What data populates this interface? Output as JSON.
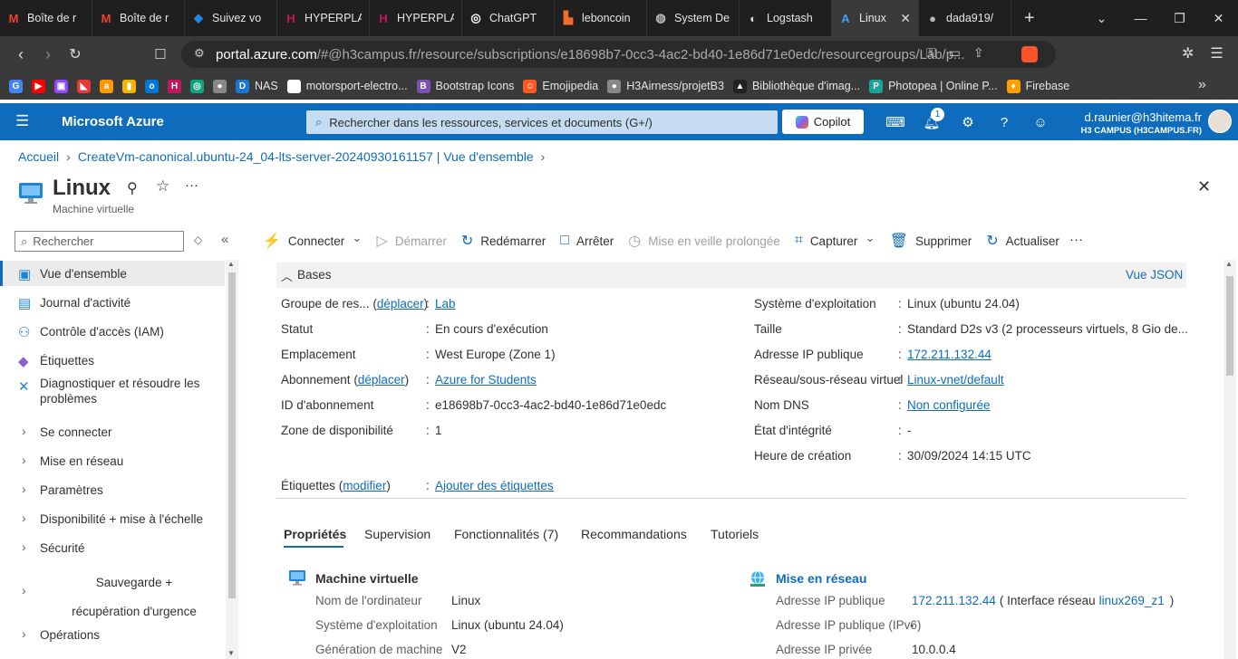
{
  "browser": {
    "tabs": [
      {
        "label": "Boîte de r",
        "icon": "gmail-icon",
        "color": "#ea4335"
      },
      {
        "label": "Boîte de r",
        "icon": "gmail-icon",
        "color": "#ea4335"
      },
      {
        "label": "Suivez vo",
        "icon": "cube-icon",
        "color": "#1e88e5"
      },
      {
        "label": "HYPERPLA",
        "icon": "hyperplan-icon",
        "color": "#c2185b"
      },
      {
        "label": "HYPERPLA",
        "icon": "hyperplan-icon",
        "color": "#c2185b"
      },
      {
        "label": "ChatGPT",
        "icon": "chatgpt-icon",
        "color": "#ffffff"
      },
      {
        "label": "leboncoin",
        "icon": "leboncoin-icon",
        "color": "#f56b2a"
      },
      {
        "label": "System De",
        "icon": "globe-icon",
        "color": "#bbbbbb"
      },
      {
        "label": "Logstash",
        "icon": "logstash-icon",
        "color": "#dddddd"
      },
      {
        "label": "Linux",
        "icon": "azure-icon",
        "color": "#3ba0ff",
        "active": true
      },
      {
        "label": "dada919/",
        "icon": "github-icon",
        "color": "#bbbbbb"
      }
    ],
    "url_host": "portal.azure.com",
    "url_rest": "/#@h3campus.fr/resource/subscriptions/e18698b7-0cc3-4ac2-bd40-1e86d71e0edc/resourcegroups/Lab/p...",
    "bookmarks": [
      {
        "label": "",
        "icon": "google-icon"
      },
      {
        "label": "",
        "icon": "youtube-icon"
      },
      {
        "label": "",
        "icon": "twitch-icon"
      },
      {
        "label": "",
        "icon": "bookmark-red-icon"
      },
      {
        "label": "",
        "icon": "amazon-icon"
      },
      {
        "label": "",
        "icon": "stats-icon"
      },
      {
        "label": "",
        "icon": "outlook-icon"
      },
      {
        "label": "",
        "icon": "hyperplan-icon"
      },
      {
        "label": "",
        "icon": "chatgpt-icon"
      },
      {
        "label": "",
        "icon": "github-icon"
      },
      {
        "label": "NAS",
        "icon": "dsm-icon"
      },
      {
        "label": "motorsport-electro...",
        "icon": "globe-icon"
      },
      {
        "label": "Bootstrap Icons",
        "icon": "bootstrap-icon"
      },
      {
        "label": "Emojipedia",
        "icon": "emoji-icon"
      },
      {
        "label": "H3Airness/projetB3",
        "icon": "github-icon"
      },
      {
        "label": "Bibliothèque d'imag...",
        "icon": "bib-icon"
      },
      {
        "label": "Photopea | Online P...",
        "icon": "photopea-icon"
      },
      {
        "label": "Firebase",
        "icon": "firebase-icon"
      }
    ]
  },
  "azure": {
    "brand": "Microsoft Azure",
    "search_placeholder": "Rechercher dans les ressources, services et documents (G+/)",
    "copilot": "Copilot",
    "notif_count": "1",
    "user_email": "d.raunier@h3hitema.fr",
    "user_tenant": "H3 CAMPUS (H3CAMPUS.FR)"
  },
  "breadcrumb": [
    "Accueil",
    "CreateVm-canonical.ubuntu-24_04-lts-server-20240930161157 | Vue d'ensemble"
  ],
  "page": {
    "title": "Linux",
    "subtitle": "Machine virtuelle",
    "more": "···"
  },
  "sidebar": {
    "search_placeholder": "Rechercher",
    "items": [
      {
        "label": "Vue d'ensemble",
        "kind": "icon",
        "icon": "monitor-icon",
        "active": true
      },
      {
        "label": "Journal d'activité",
        "kind": "icon",
        "icon": "log-icon"
      },
      {
        "label": "Contrôle d'accès (IAM)",
        "kind": "icon",
        "icon": "people-icon"
      },
      {
        "label": "Étiquettes",
        "kind": "icon",
        "icon": "tag-icon"
      },
      {
        "label": "Diagnostiquer et résoudre les problèmes",
        "kind": "icon",
        "icon": "wrench-icon"
      },
      {
        "label": "Se connecter",
        "kind": "chev"
      },
      {
        "label": "Mise en réseau",
        "kind": "chev"
      },
      {
        "label": "Paramètres",
        "kind": "chev"
      },
      {
        "label": "Disponibilité + mise à l'échelle",
        "kind": "chev"
      },
      {
        "label": "Sécurité",
        "kind": "chev"
      },
      {
        "label": "Sauvegarde + récupération d'urgence",
        "kind": "chev"
      },
      {
        "label": "Opérations",
        "kind": "chev"
      }
    ]
  },
  "commands": [
    {
      "label": "Connecter",
      "icon": "plug-icon",
      "dropdown": true
    },
    {
      "label": "Démarrer",
      "icon": "play-icon",
      "disabled": true
    },
    {
      "label": "Redémarrer",
      "icon": "restart-icon"
    },
    {
      "label": "Arrêter",
      "icon": "stop-icon"
    },
    {
      "label": "Mise en veille prolongée",
      "icon": "clock-icon",
      "disabled": true
    },
    {
      "label": "Capturer",
      "icon": "capture-icon",
      "dropdown": true
    },
    {
      "label": "Supprimer",
      "icon": "trash-icon"
    },
    {
      "label": "Actualiser",
      "icon": "refresh-icon"
    }
  ],
  "essentials": {
    "header": "Bases",
    "json_view": "Vue JSON",
    "left": [
      {
        "label": "Groupe de res...",
        "action": "déplacer",
        "value": "Lab",
        "link": true
      },
      {
        "label": "Statut",
        "value": "En cours d'exécution"
      },
      {
        "label": "Emplacement",
        "value": "West Europe (Zone 1)"
      },
      {
        "label": "Abonnement",
        "action": "déplacer",
        "value": "Azure for Students",
        "link": true
      },
      {
        "label": "ID d'abonnement",
        "value": "e18698b7-0cc3-4ac2-bd40-1e86d71e0edc"
      },
      {
        "label": "Zone de disponibilité",
        "value": "1"
      }
    ],
    "right": [
      {
        "label": "Système d'exploitation",
        "value": "Linux (ubuntu 24.04)"
      },
      {
        "label": "Taille",
        "value": "Standard D2s v3 (2 processeurs virtuels, 8 Gio de..."
      },
      {
        "label": "Adresse IP publique",
        "value": "172.211.132.44",
        "link": true
      },
      {
        "label": "Réseau/sous-réseau virtuel",
        "value": "Linux-vnet/default",
        "link": true
      },
      {
        "label": "Nom DNS",
        "value": "Non configurée",
        "link": true
      },
      {
        "label": "État d'intégrité",
        "value": "-"
      },
      {
        "label": "Heure de création",
        "value": "30/09/2024 14:15 UTC"
      }
    ],
    "tags_label": "Étiquettes",
    "tags_action": "modifier",
    "tags_value": "Ajouter des étiquettes"
  },
  "tabs": [
    {
      "label": "Propriétés",
      "active": true
    },
    {
      "label": "Supervision"
    },
    {
      "label": "Fonctionnalités (7)"
    },
    {
      "label": "Recommandations"
    },
    {
      "label": "Tutoriels"
    }
  ],
  "props": {
    "vm_title": "Machine virtuelle",
    "vm_rows": [
      {
        "label": "Nom de l'ordinateur",
        "value": "Linux"
      },
      {
        "label": "Système d'exploitation",
        "value": "Linux (ubuntu 24.04)"
      },
      {
        "label": "Génération de machine",
        "value": "V2"
      }
    ],
    "net_title": "Mise en réseau",
    "net_rows": [
      {
        "label": "Adresse IP publique",
        "value": "172.211.132.44",
        "extra_pre": "( Interface réseau",
        "extra_link": "linux269_z1",
        "extra_post": ")"
      },
      {
        "label": "Adresse IP publique (IPv6)",
        "value": "-"
      },
      {
        "label": "Adresse IP privée",
        "value": "10.0.0.4"
      }
    ]
  }
}
